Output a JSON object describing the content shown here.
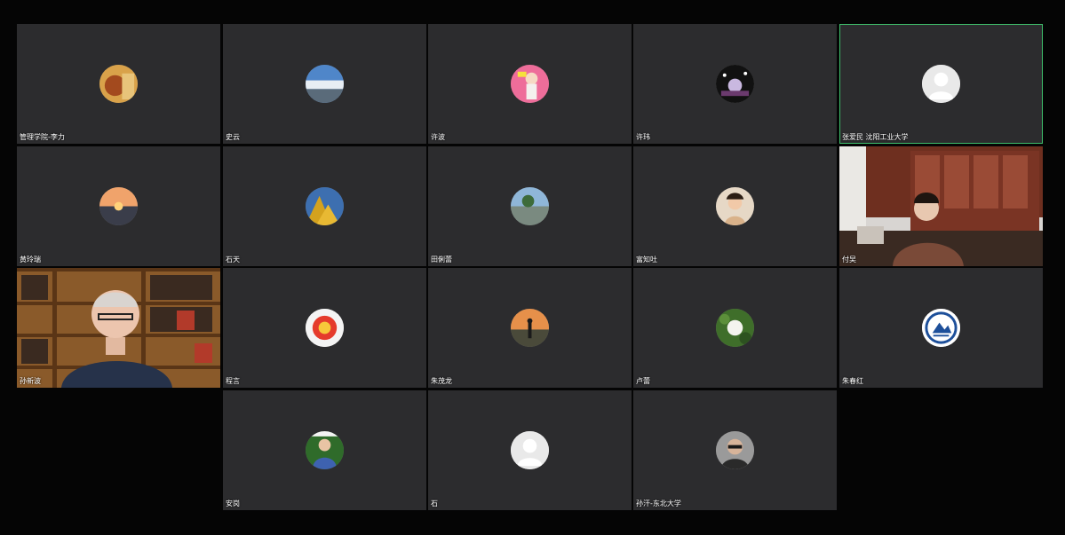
{
  "participants": [
    {
      "name": "管理学院-李力"
    },
    {
      "name": "史云"
    },
    {
      "name": "许波"
    },
    {
      "name": "许玮"
    },
    {
      "name": "张爱民 沈阳工业大学"
    },
    {
      "name": "黄玲瑞"
    },
    {
      "name": "石天"
    },
    {
      "name": "田俐蕾"
    },
    {
      "name": "富知吐"
    },
    {
      "name": "付吴"
    },
    {
      "name": "孙新波"
    },
    {
      "name": "程言"
    },
    {
      "name": "朱茂龙"
    },
    {
      "name": "卢蕾"
    },
    {
      "name": "朱春红"
    },
    {
      "name": "安岗"
    },
    {
      "name": "石"
    },
    {
      "name": "孙汗-东北大学"
    }
  ],
  "active_speaker_color": "#3fbf6b"
}
